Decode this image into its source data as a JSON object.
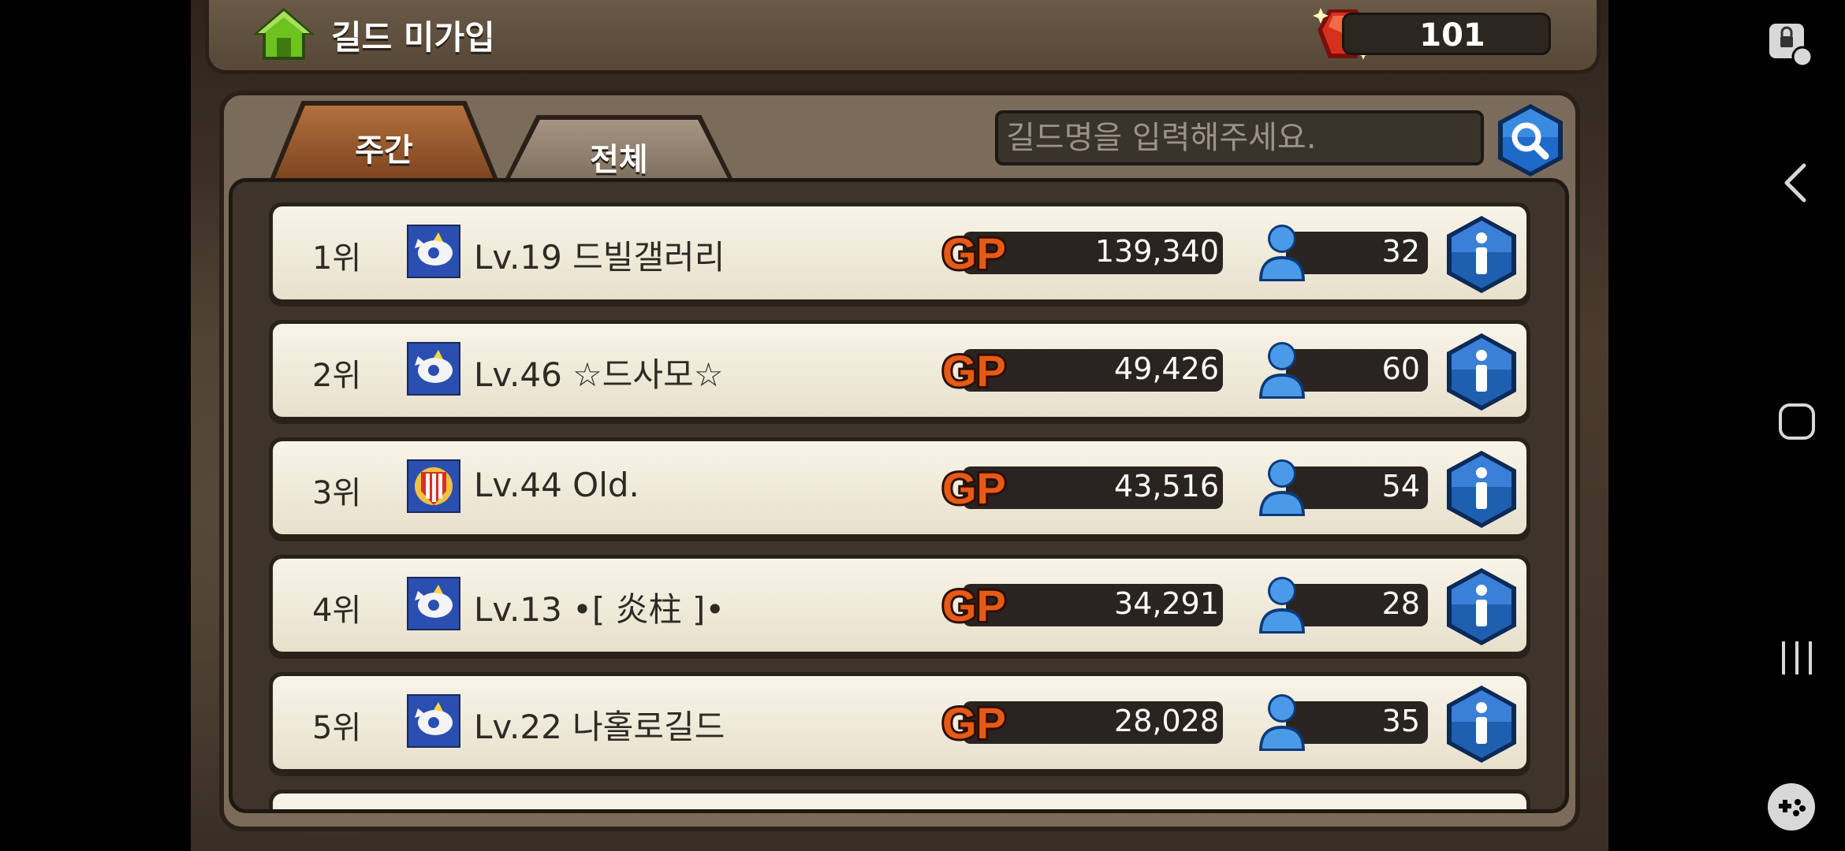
{
  "header": {
    "title": "길드 미가입",
    "gem_count": "101"
  },
  "tabs": [
    {
      "label": "주간",
      "active": true
    },
    {
      "label": "전체",
      "active": false
    }
  ],
  "search": {
    "placeholder": "길드명을 입력해주세요."
  },
  "guild_rows": [
    {
      "rank": "1위",
      "name": "Lv.19 드빌갤러리",
      "gp": "139,340",
      "members": "32",
      "emblem": "dragon-emblem-icon"
    },
    {
      "rank": "2위",
      "name": "Lv.46 ☆드사모☆",
      "gp": "49,426",
      "members": "60",
      "emblem": "dragon-emblem-icon"
    },
    {
      "rank": "3위",
      "name": "Lv.44 Old.",
      "gp": "43,516",
      "members": "54",
      "emblem": "shield-emblem-icon"
    },
    {
      "rank": "4위",
      "name": "Lv.13 •[ 炎柱 ]•",
      "gp": "34,291",
      "members": "28",
      "emblem": "dragon-emblem-icon"
    },
    {
      "rank": "5위",
      "name": "Lv.22 나홀로길드",
      "gp": "28,028",
      "members": "35",
      "emblem": "dragon-emblem-icon"
    }
  ],
  "colors": {
    "gp_orange": "#e85a14",
    "info_blue": "#1f5fb0",
    "home_green": "#6cc21e",
    "gem_red": "#d8301e"
  }
}
